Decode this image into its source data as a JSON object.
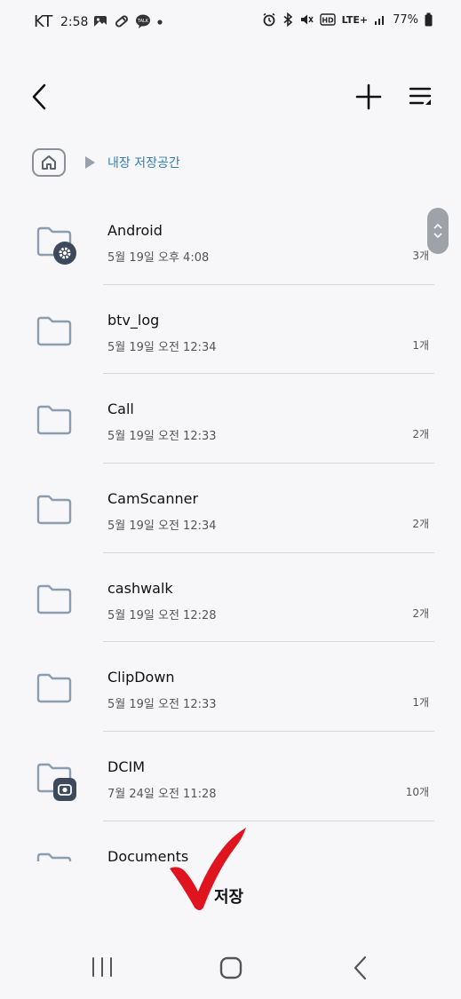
{
  "status_bar": {
    "carrier": "KT",
    "time": "2:58",
    "network": "LTE+",
    "battery": "77%"
  },
  "top_bar": {
    "back_icon": "chevron-left-icon",
    "add_icon": "plus-icon",
    "menu_icon": "sort-menu-icon"
  },
  "breadcrumb": {
    "home_icon": "home-icon",
    "current": "내장 저장공간"
  },
  "folders": [
    {
      "name": "Android",
      "date": "5월 19일 오후 4:08",
      "count": "3개",
      "badge": "settings-badge-icon"
    },
    {
      "name": "btv_log",
      "date": "5월 19일 오전 12:34",
      "count": "1개",
      "badge": ""
    },
    {
      "name": "Call",
      "date": "5월 19일 오전 12:33",
      "count": "2개",
      "badge": ""
    },
    {
      "name": "CamScanner",
      "date": "5월 19일 오전 12:34",
      "count": "2개",
      "badge": ""
    },
    {
      "name": "cashwalk",
      "date": "5월 19일 오전 12:28",
      "count": "2개",
      "badge": ""
    },
    {
      "name": "ClipDown",
      "date": "5월 19일 오전 12:33",
      "count": "1개",
      "badge": ""
    },
    {
      "name": "DCIM",
      "date": "7월 24일 오전 11:28",
      "count": "10개",
      "badge": "camera-badge-icon"
    },
    {
      "name": "Documents",
      "date": "",
      "count": "",
      "badge": ""
    }
  ],
  "annotation": {
    "label": "저장",
    "color": "#e0141e"
  },
  "colors": {
    "accent": "#2c7fb8",
    "folder_stroke": "#8d9db0",
    "badge": "#3d4a5c"
  }
}
